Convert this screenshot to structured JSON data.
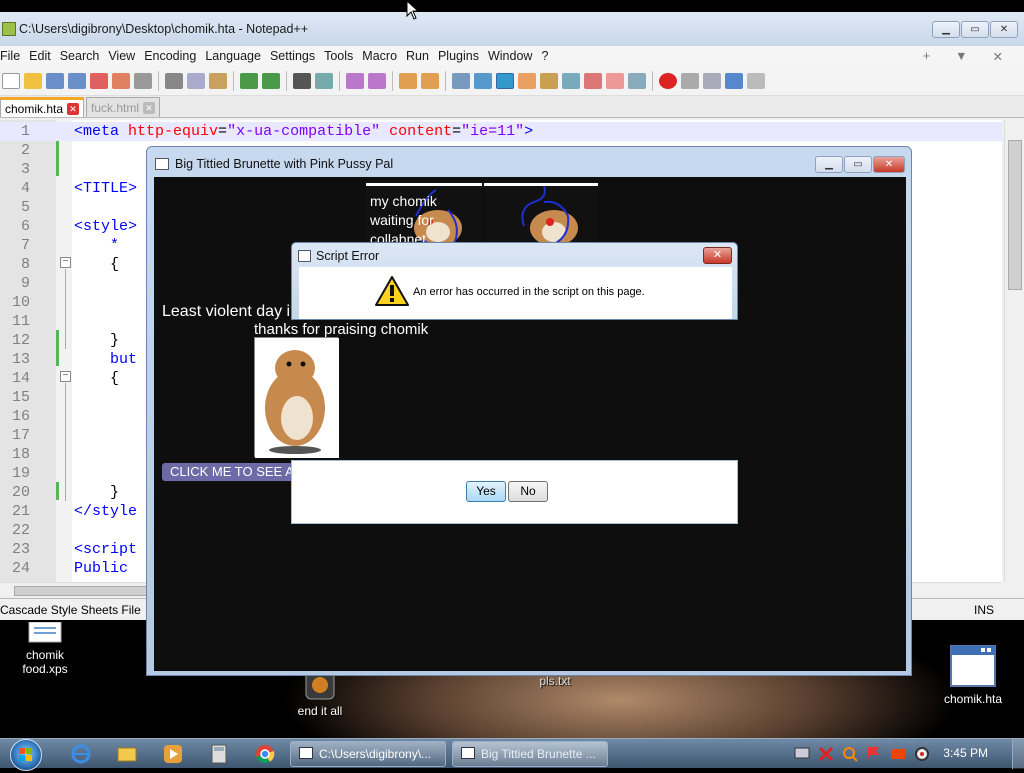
{
  "desktop": {
    "icons": [
      {
        "label1": "chomik",
        "label2": "food.xps"
      },
      {
        "label1": "end it all"
      },
      {
        "label1": "pls.txt"
      },
      {
        "label1": "chomik.hta"
      }
    ]
  },
  "npp": {
    "title": "C:\\Users\\digibrony\\Desktop\\chomik.hta - Notepad++",
    "menu": [
      "File",
      "Edit",
      "Search",
      "View",
      "Encoding",
      "Language",
      "Settings",
      "Tools",
      "Macro",
      "Run",
      "Plugins",
      "Window",
      "?"
    ],
    "menu_right": [
      "+",
      "▼",
      "✕"
    ],
    "tabs": [
      {
        "label": "chomik.hta",
        "active": true
      },
      {
        "label": "fuck.html",
        "active": false
      }
    ],
    "lines": [
      {
        "n": "1",
        "text": "<meta http-equiv=\"x-ua-compatible\" content=\"ie=11\">"
      },
      {
        "n": "2",
        "text": ""
      },
      {
        "n": "3",
        "text": ""
      },
      {
        "n": "4",
        "text": "<TITLE>"
      },
      {
        "n": "5",
        "text": ""
      },
      {
        "n": "6",
        "text": "<style>"
      },
      {
        "n": "7",
        "text": "    *"
      },
      {
        "n": "8",
        "text": "    {"
      },
      {
        "n": "9",
        "text": ""
      },
      {
        "n": "10",
        "text": ""
      },
      {
        "n": "11",
        "text": ""
      },
      {
        "n": "12",
        "text": "    }"
      },
      {
        "n": "13",
        "text": "    but"
      },
      {
        "n": "14",
        "text": "    {"
      },
      {
        "n": "15",
        "text": ""
      },
      {
        "n": "16",
        "text": ""
      },
      {
        "n": "17",
        "text": ""
      },
      {
        "n": "18",
        "text": ""
      },
      {
        "n": "19",
        "text": ""
      },
      {
        "n": "20",
        "text": "    }"
      },
      {
        "n": "21",
        "text": "</style"
      },
      {
        "n": "22",
        "text": ""
      },
      {
        "n": "23",
        "text": "<script"
      },
      {
        "n": "24",
        "text": "Public"
      }
    ],
    "status_left": "Cascade Style Sheets File",
    "status_right": "INS"
  },
  "hta": {
    "title": "Big Tittied Brunette with Pink Pussy Pal",
    "caption_lines": [
      "my chomik",
      "waiting for",
      "collabnet"
    ],
    "text_violent": "Least violent day i",
    "text_praise": "thanks for praising chomik",
    "click_button": "CLICK ME TO SEE A PICTURE OF CHOMIK BUT NAKEDD"
  },
  "dialog": {
    "title": "Script Error",
    "message": "An error has occurred in the script on this page.",
    "yes": "Yes",
    "no": "No"
  },
  "taskbar": {
    "tasks": [
      {
        "label": "C:\\Users\\digibrony\\..."
      },
      {
        "label": "Big Tittied Brunette ..."
      }
    ],
    "clock": "3:45 PM"
  },
  "colors": {
    "code_tag": "#0000ff",
    "code_attr": "#ff0000",
    "code_str": "#8000ff",
    "click_button_bg": "#6d6aa8"
  }
}
